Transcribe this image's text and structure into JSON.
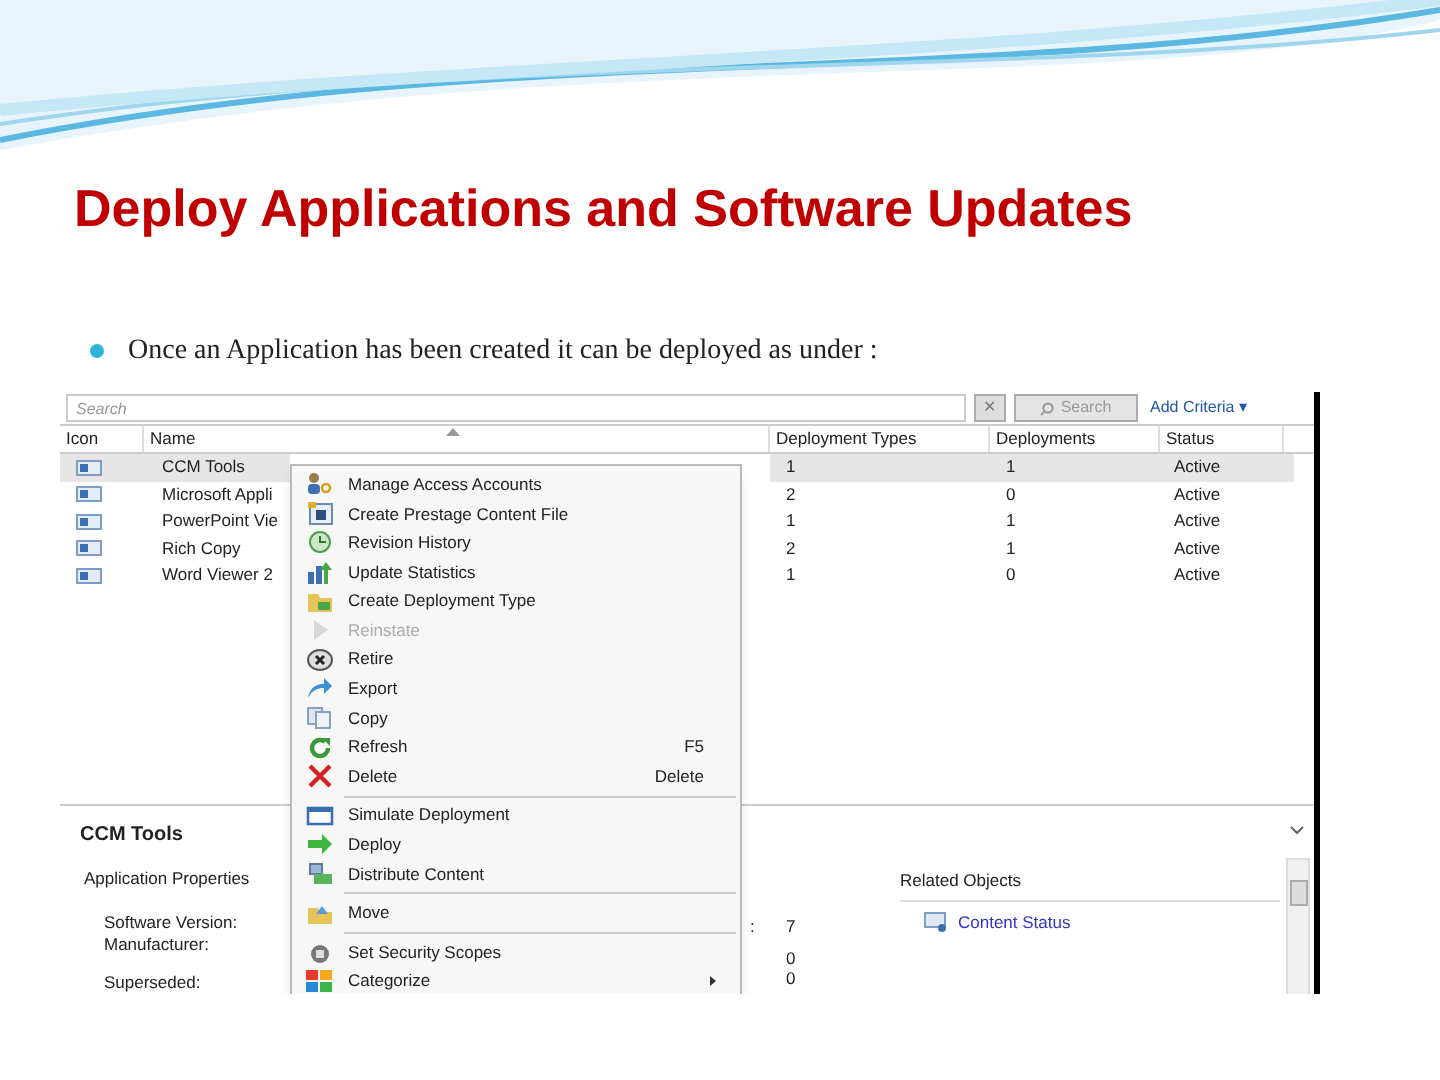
{
  "slide": {
    "title": "Deploy Applications and Software Updates",
    "bullet": "Once an Application has been created it can be deployed as under :"
  },
  "console": {
    "search": {
      "placeholder": "Search",
      "clear_button": "✕",
      "search_button": "Search",
      "add_criteria": "Add Criteria ▾"
    },
    "table": {
      "columns": [
        "Icon",
        "Name",
        "Deployment Types",
        "Deployments",
        "Status"
      ],
      "rows": [
        {
          "name": "CCM Tools",
          "deployment_types": "1",
          "deployments": "1",
          "status": "Active",
          "selected": true
        },
        {
          "name": "Microsoft Appli",
          "deployment_types": "2",
          "deployments": "0",
          "status": "Active",
          "selected": false
        },
        {
          "name": "PowerPoint Vie",
          "deployment_types": "1",
          "deployments": "1",
          "status": "Active",
          "selected": false
        },
        {
          "name": "Rich Copy",
          "deployment_types": "2",
          "deployments": "1",
          "status": "Active",
          "selected": false
        },
        {
          "name": "Word Viewer 2",
          "deployment_types": "1",
          "deployments": "0",
          "status": "Active",
          "selected": false
        }
      ]
    },
    "details": {
      "title": "CCM Tools",
      "section": "Application Properties",
      "properties": [
        "Software Version:",
        "Manufacturer:",
        "Superseded:"
      ],
      "values": [
        "7",
        "0",
        "0"
      ],
      "value_colon": ":",
      "related_heading": "Related Objects",
      "related_link": "Content Status"
    },
    "context_menu": [
      {
        "label": "Manage Access Accounts",
        "disabled": false,
        "separator_before": false
      },
      {
        "label": "Create Prestage Content File",
        "disabled": false,
        "separator_before": false
      },
      {
        "label": "Revision History",
        "disabled": false,
        "separator_before": false
      },
      {
        "label": "Update Statistics",
        "disabled": false,
        "separator_before": false
      },
      {
        "label": "Create Deployment Type",
        "disabled": false,
        "separator_before": false
      },
      {
        "label": "Reinstate",
        "disabled": true,
        "separator_before": false
      },
      {
        "label": "Retire",
        "disabled": false,
        "separator_before": false
      },
      {
        "label": "Export",
        "disabled": false,
        "separator_before": false
      },
      {
        "label": "Copy",
        "disabled": false,
        "separator_before": false
      },
      {
        "label": "Refresh",
        "shortcut": "F5",
        "disabled": false,
        "separator_before": false
      },
      {
        "label": "Delete",
        "shortcut": "Delete",
        "disabled": false,
        "separator_before": false
      },
      {
        "label": "Simulate Deployment",
        "disabled": false,
        "separator_before": true
      },
      {
        "label": "Deploy",
        "disabled": false,
        "separator_before": false
      },
      {
        "label": "Distribute Content",
        "disabled": false,
        "separator_before": false
      },
      {
        "label": "Move",
        "disabled": false,
        "separator_before": true
      },
      {
        "label": "Set Security Scopes",
        "disabled": false,
        "separator_before": true
      },
      {
        "label": "Categorize",
        "submenu": true,
        "disabled": false,
        "separator_before": false
      }
    ]
  }
}
